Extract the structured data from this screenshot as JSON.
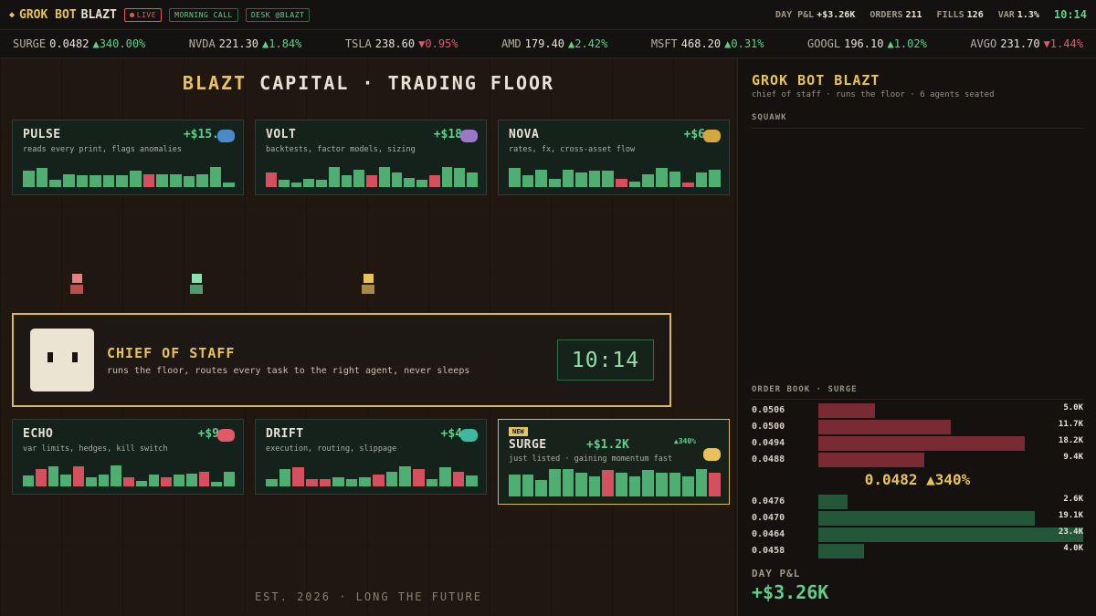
{
  "topbar": {
    "brand_part1": "GROK BOT",
    "brand_part2": "BLAZT",
    "live_label": "LIVE",
    "morning_call_label": "MORNING CALL",
    "desk_label": "DESK @BLAZT",
    "stats": [
      {
        "label": "DAY P&L",
        "value": "+$3.26K"
      },
      {
        "label": "ORDERS",
        "value": "211"
      },
      {
        "label": "FILLS",
        "value": "126"
      },
      {
        "label": "VAR",
        "value": "1.3%"
      }
    ],
    "clock": "10:14"
  },
  "ticker": [
    {
      "symbol": "SURGE",
      "price": "0.0482",
      "change": "▲340.00%",
      "dir": "up"
    },
    {
      "symbol": "NVDA",
      "price": "221.30",
      "change": "▲1.84%",
      "dir": "up"
    },
    {
      "symbol": "TSLA",
      "price": "238.60",
      "change": "▼0.95%",
      "dir": "down"
    },
    {
      "symbol": "AMD",
      "price": "179.40",
      "change": "▲2.42%",
      "dir": "up"
    },
    {
      "symbol": "MSFT",
      "price": "468.20",
      "change": "▲0.31%",
      "dir": "up"
    },
    {
      "symbol": "GOOGL",
      "price": "196.10",
      "change": "▲1.02%",
      "dir": "up"
    },
    {
      "symbol": "AVGO",
      "price": "231.70",
      "change": "▼1.44%",
      "dir": "down"
    }
  ],
  "floor": {
    "title_part1": "BLAZT",
    "title_part2": "CAPITAL · TRADING FLOOR",
    "est": "EST. 2026 · LONG THE FUTURE"
  },
  "agents": [
    {
      "name": "PULSE",
      "pnl": "+$15.",
      "desc": "reads every print, flags anomalies",
      "chip_color": "#4a8ac8",
      "bars": [
        [
          0.7,
          1
        ],
        [
          0.8,
          1
        ],
        [
          0.3,
          1
        ],
        [
          0.55,
          1
        ],
        [
          0.5,
          1
        ],
        [
          0.5,
          1
        ],
        [
          0.5,
          1
        ],
        [
          0.5,
          1
        ],
        [
          0.7,
          1
        ],
        [
          0.55,
          0
        ],
        [
          0.55,
          1
        ],
        [
          0.55,
          1
        ],
        [
          0.45,
          1
        ],
        [
          0.55,
          1
        ],
        [
          0.85,
          1
        ],
        [
          0.2,
          1
        ]
      ]
    },
    {
      "name": "VOLT",
      "pnl": "+$18",
      "desc": "backtests, factor models, sizing",
      "chip_color": "#9a78c8",
      "bars": [
        [
          0.6,
          0
        ],
        [
          0.3,
          1
        ],
        [
          0.2,
          1
        ],
        [
          0.35,
          1
        ],
        [
          0.3,
          1
        ],
        [
          0.85,
          1
        ],
        [
          0.5,
          1
        ],
        [
          0.75,
          1
        ],
        [
          0.5,
          0
        ],
        [
          0.85,
          1
        ],
        [
          0.6,
          1
        ],
        [
          0.4,
          1
        ],
        [
          0.3,
          1
        ],
        [
          0.5,
          0
        ],
        [
          0.85,
          1
        ],
        [
          0.8,
          1
        ],
        [
          0.6,
          1
        ]
      ]
    },
    {
      "name": "NOVA",
      "pnl": "+$6",
      "desc": "rates, fx, cross-asset flow",
      "chip_color": "#d4a840",
      "bars": [
        [
          0.8,
          1
        ],
        [
          0.5,
          1
        ],
        [
          0.75,
          1
        ],
        [
          0.35,
          1
        ],
        [
          0.75,
          1
        ],
        [
          0.6,
          1
        ],
        [
          0.7,
          1
        ],
        [
          0.7,
          1
        ],
        [
          0.35,
          0
        ],
        [
          0.25,
          1
        ],
        [
          0.55,
          1
        ],
        [
          0.8,
          1
        ],
        [
          0.65,
          1
        ],
        [
          0.2,
          0
        ],
        [
          0.6,
          1
        ],
        [
          0.75,
          1
        ]
      ]
    },
    {
      "name": "ECHO",
      "pnl": "+$9",
      "desc": "var limits, hedges, kill switch",
      "chip_color": "#e05a6a",
      "bars": [
        [
          0.45,
          1
        ],
        [
          0.75,
          0
        ],
        [
          0.85,
          1
        ],
        [
          0.5,
          1
        ],
        [
          0.85,
          0
        ],
        [
          0.4,
          1
        ],
        [
          0.5,
          1
        ],
        [
          0.9,
          1
        ],
        [
          0.4,
          0
        ],
        [
          0.25,
          1
        ],
        [
          0.5,
          1
        ],
        [
          0.4,
          0
        ],
        [
          0.5,
          1
        ],
        [
          0.55,
          1
        ],
        [
          0.6,
          0
        ],
        [
          0.2,
          1
        ],
        [
          0.6,
          1
        ]
      ]
    },
    {
      "name": "DRIFT",
      "pnl": "+$4",
      "desc": "execution, routing, slippage",
      "chip_color": "#3fb8a0",
      "bars": [
        [
          0.3,
          1
        ],
        [
          0.75,
          1
        ],
        [
          0.8,
          0
        ],
        [
          0.3,
          0
        ],
        [
          0.3,
          0
        ],
        [
          0.4,
          1
        ],
        [
          0.3,
          1
        ],
        [
          0.4,
          1
        ],
        [
          0.5,
          0
        ],
        [
          0.6,
          1
        ],
        [
          0.85,
          1
        ],
        [
          0.75,
          0
        ],
        [
          0.3,
          1
        ],
        [
          0.8,
          1
        ],
        [
          0.6,
          0
        ],
        [
          0.45,
          1
        ]
      ]
    },
    {
      "name": "SURGE",
      "pnl": "+$1.2K",
      "pct": "▲340%",
      "new_label": "NEW",
      "desc": "just listed · gaining momentum fast",
      "chip_color": "#e8c35a",
      "bars": [
        [
          0.75,
          1
        ],
        [
          0.75,
          1
        ],
        [
          0.55,
          1
        ],
        [
          0.95,
          1
        ],
        [
          0.95,
          1
        ],
        [
          0.8,
          1
        ],
        [
          0.7,
          1
        ],
        [
          0.9,
          0
        ],
        [
          0.8,
          1
        ],
        [
          0.7,
          1
        ],
        [
          0.9,
          1
        ],
        [
          0.8,
          1
        ],
        [
          0.8,
          1
        ],
        [
          0.7,
          1
        ],
        [
          0.95,
          1
        ],
        [
          0.8,
          0
        ]
      ]
    }
  ],
  "floor_avatars": [
    {
      "head": "#e88080",
      "body": "#b85050"
    },
    {
      "head": "#8fe0b0",
      "body": "#4f9a70"
    },
    {
      "head": "#e8c35a",
      "body": "#a88a40"
    }
  ],
  "chief": {
    "title": "CHIEF OF STAFF",
    "subtitle": "runs the floor, routes every task to the right agent, never sleeps",
    "clock": "10:14"
  },
  "panel": {
    "title": "GROK BOT BLAZT",
    "subtitle": "chief of staff · runs the floor · 6 agents seated",
    "squawk_label": "SQUAWK",
    "orderbook_label": "ORDER BOOK · SURGE",
    "asks": [
      {
        "price": "0.0506",
        "size": "5.0K",
        "size_value": 5.0
      },
      {
        "price": "0.0500",
        "size": "11.7K",
        "size_value": 11.7
      },
      {
        "price": "0.0494",
        "size": "18.2K",
        "size_value": 18.2
      },
      {
        "price": "0.0488",
        "size": "9.4K",
        "size_value": 9.4
      }
    ],
    "mid": "0.0482 ▲340%",
    "bids": [
      {
        "price": "0.0476",
        "size": "2.6K",
        "size_value": 2.6
      },
      {
        "price": "0.0470",
        "size": "19.1K",
        "size_value": 19.1
      },
      {
        "price": "0.0464",
        "size": "23.4K",
        "size_value": 23.4
      },
      {
        "price": "0.0458",
        "size": "4.0K",
        "size_value": 4.0
      }
    ],
    "day_pnl_label": "DAY P&L",
    "day_pnl_value": "+$3.26K"
  }
}
